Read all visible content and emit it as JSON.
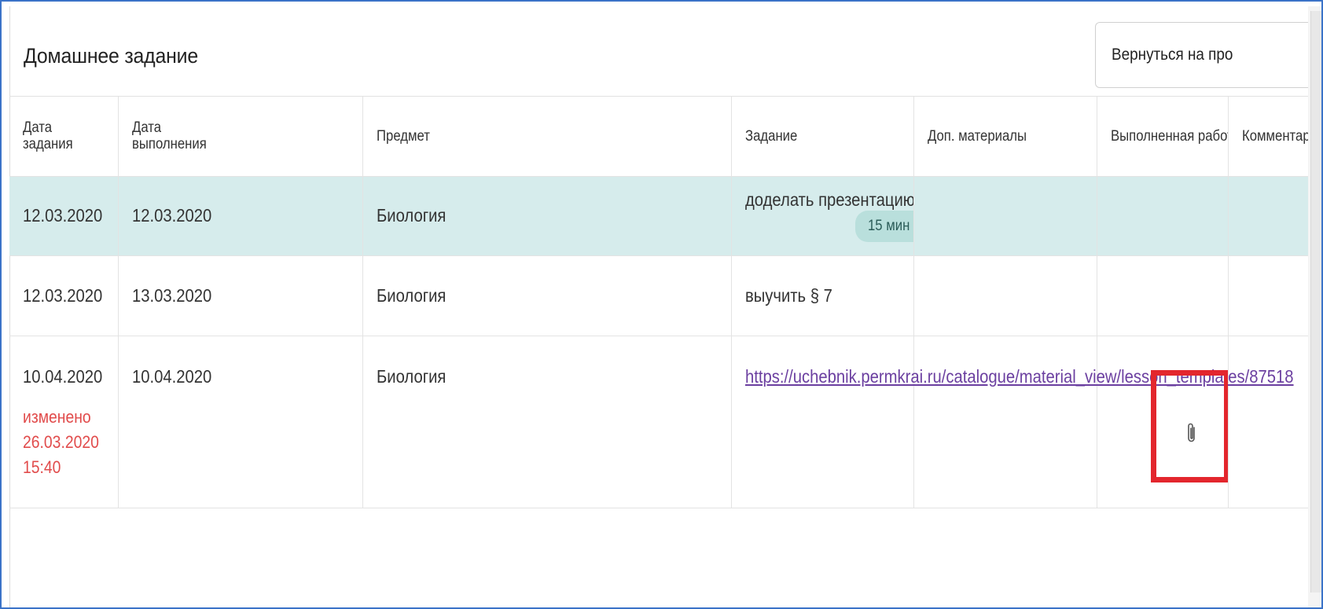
{
  "header": {
    "title": "Домашнее задание",
    "back_button_label": "Вернуться на про"
  },
  "table": {
    "columns": [
      "Дата задания",
      "Дата выполнения",
      "Предмет",
      "Задание",
      "Доп. материалы",
      "Выполненная работа",
      "Комментарии"
    ],
    "columns_html": {
      "date_assigned_line1": "Дата",
      "date_assigned_line2": "задания",
      "date_due_line1": "Дата",
      "date_due_line2": "выполнения"
    },
    "rows": [
      {
        "date_assigned": "12.03.2020",
        "date_due": "12.03.2020",
        "subject": "Биология",
        "task": "доделать презентацию,",
        "duration": "15 мин",
        "highlighted": true
      },
      {
        "date_assigned": "12.03.2020",
        "date_due": "13.03.2020",
        "subject": "Биология",
        "task": "выучить § 7"
      },
      {
        "date_assigned": "10.04.2020",
        "changed_label": "изменено",
        "changed_date": "26.03.2020",
        "changed_time": "15:40",
        "date_due": "10.04.2020",
        "subject": "Биология",
        "task_link": "https://uchebnik.permkrai.ru/catalogue/material_view/lesson_templates/87518",
        "completed_work_icon": "paperclip-icon"
      }
    ]
  },
  "colors": {
    "highlight_row": "#d6ecec",
    "badge": "#b9dfdc",
    "link": "#6b3fa0",
    "changed_text": "#e14b4b",
    "annotation_box": "#e3262d",
    "frame_border": "#3b73c8"
  }
}
